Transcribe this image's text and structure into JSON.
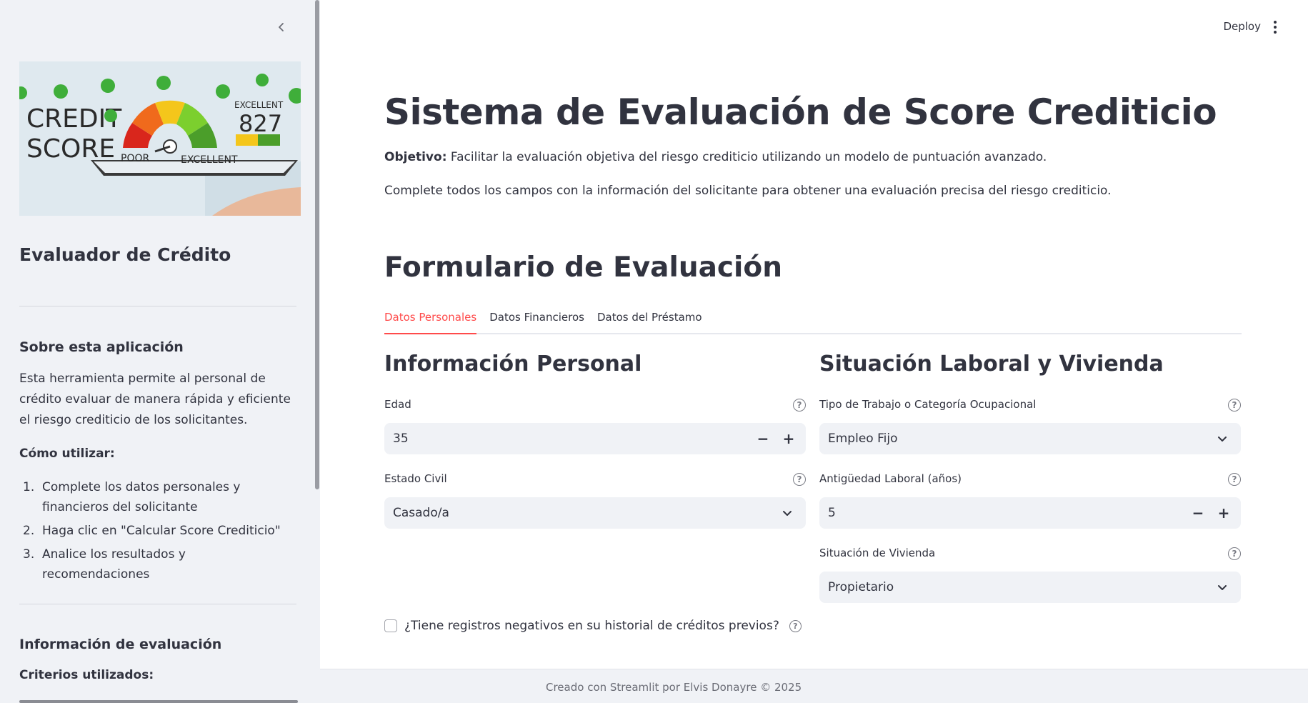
{
  "sidebar": {
    "image_text": {
      "word1": "CREDIT",
      "word2": "SCORE",
      "gauge_low": "POOR",
      "gauge_high": "EXCELLENT",
      "rating": "EXCELLENT",
      "score": "827"
    },
    "title": "Evaluador de Crédito",
    "about_heading": "Sobre esta aplicación",
    "about_text": "Esta herramienta permite al personal de crédito evaluar de manera rápida y eficiente el riesgo crediticio de los solicitantes.",
    "howto_heading": "Cómo utilizar:",
    "steps": [
      {
        "num": "1.",
        "text": "Complete los datos personales y financieros del solicitante"
      },
      {
        "num": "2.",
        "text": "Haga clic en \"Calcular Score Crediticio\""
      },
      {
        "num": "3.",
        "text": "Analice los resultados y recomendaciones"
      }
    ],
    "eval_heading": "Información de evaluación",
    "criteria_heading": "Criterios utilizados:"
  },
  "header": {
    "deploy_label": "Deploy"
  },
  "main": {
    "title": "Sistema de Evaluación de Score Crediticio",
    "objective_label": "Objetivo:",
    "objective_text": "Facilitar la evaluación objetiva del riesgo crediticio utilizando un modelo de puntuación avanzado.",
    "instructions": "Complete todos los campos con la información del solicitante para obtener una evaluación precisa del riesgo crediticio.",
    "form_title": "Formulario de Evaluación",
    "tabs": [
      {
        "label": "Datos Personales"
      },
      {
        "label": "Datos Financieros"
      },
      {
        "label": "Datos del Préstamo"
      }
    ],
    "personal": {
      "title": "Información Personal",
      "age_label": "Edad",
      "age_value": "35",
      "civil_label": "Estado Civil",
      "civil_value": "Casado/a"
    },
    "work": {
      "title": "Situación Laboral y Vivienda",
      "job_label": "Tipo de Trabajo o Categoría Ocupacional",
      "job_value": "Empleo Fijo",
      "tenure_label": "Antigüedad Laboral (años)",
      "tenure_value": "5",
      "housing_label": "Situación de Vivienda",
      "housing_value": "Propietario"
    },
    "checkbox_label": "¿Tiene registros negativos en su historial de créditos previos?",
    "footer": "Creado con Streamlit por Elvis Donayre © 2025"
  },
  "colors": {
    "accent": "#ff4b4b",
    "sidebar_bg": "#f0f2f6",
    "text": "#31333f"
  }
}
